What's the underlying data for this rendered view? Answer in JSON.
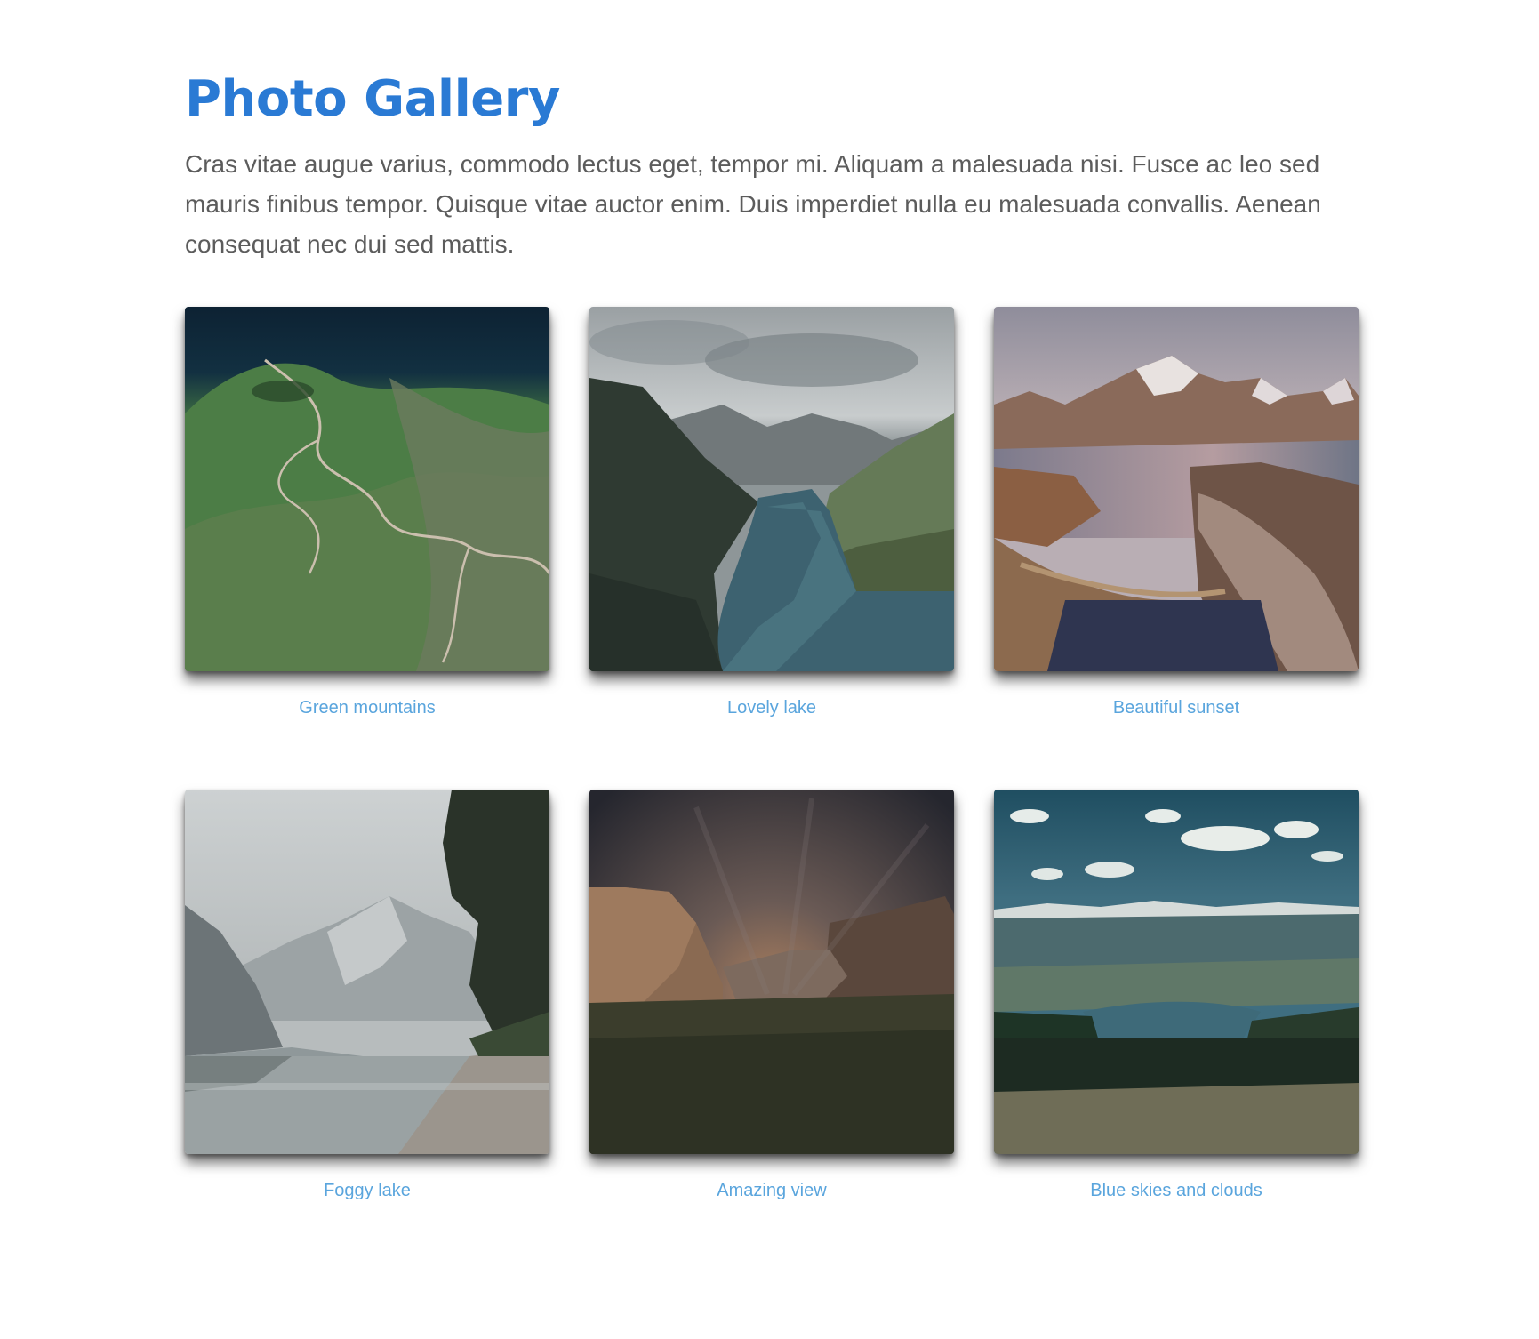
{
  "header": {
    "title": "Photo Gallery",
    "intro": "Cras vitae augue varius, commodo lectus eget, tempor mi. Aliquam a malesuada nisi. Fusce ac leo sed mauris finibus tempor. Quisque vitae auctor enim. Duis imperdiet nulla eu malesuada convallis. Aenean consequat nec dui sed mattis."
  },
  "gallery": {
    "items": [
      {
        "caption": "Green mountains"
      },
      {
        "caption": "Lovely lake"
      },
      {
        "caption": "Beautiful sunset"
      },
      {
        "caption": "Foggy lake"
      },
      {
        "caption": "Amazing view"
      },
      {
        "caption": "Blue skies and clouds"
      }
    ]
  },
  "colors": {
    "title": "#2a7ad4",
    "body_text": "#5c5c5c",
    "caption": "#5aa5dd",
    "background": "#ffffff"
  }
}
